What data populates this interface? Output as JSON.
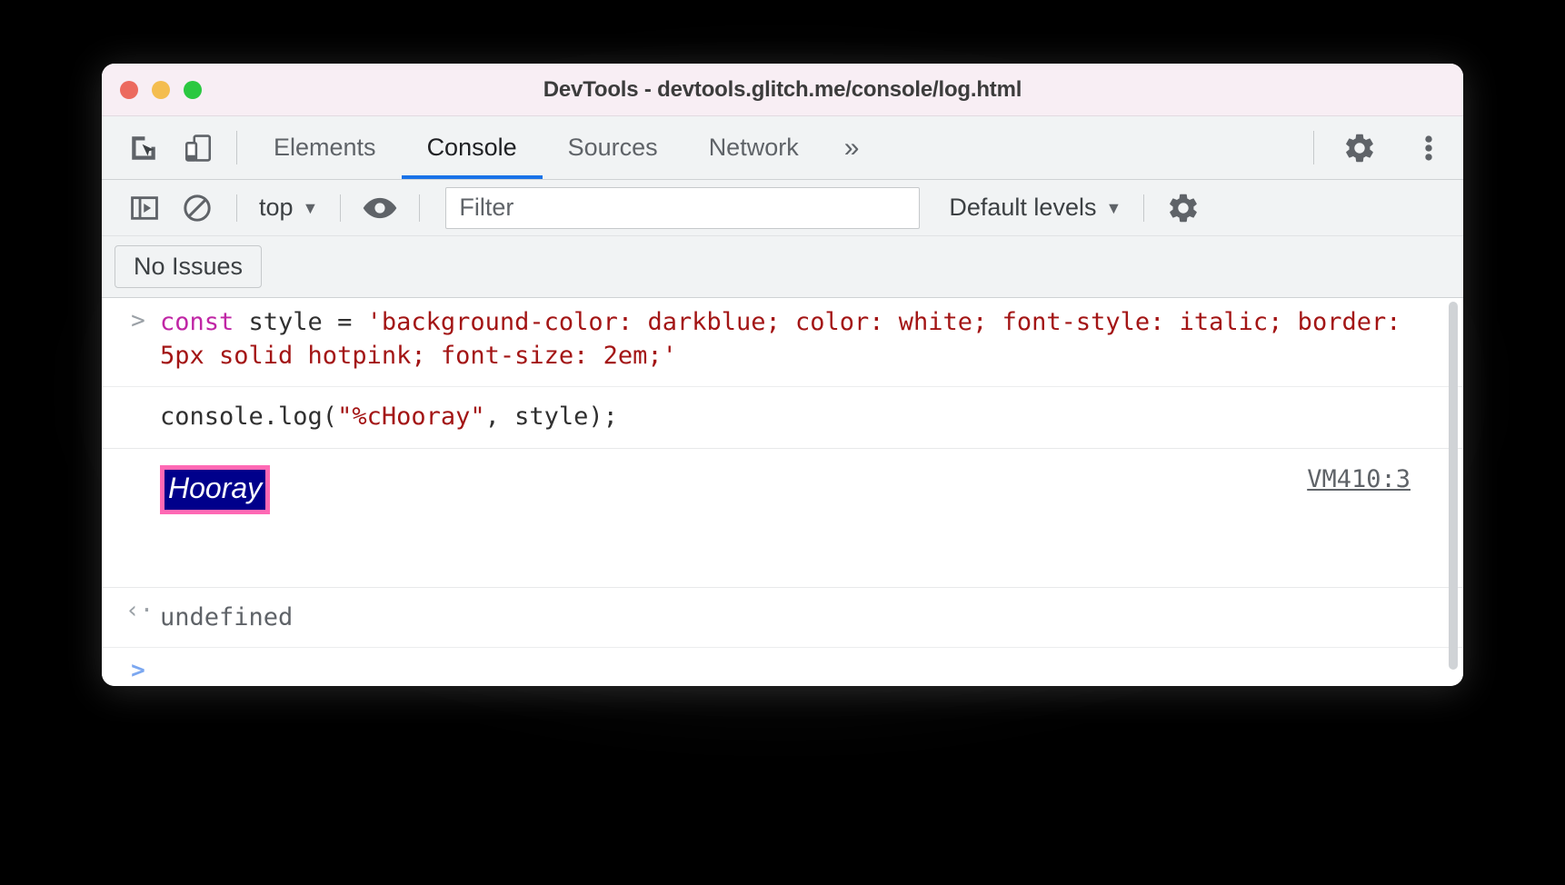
{
  "window": {
    "title": "DevTools - devtools.glitch.me/console/log.html",
    "traffic_lights": [
      "close",
      "minimize",
      "maximize"
    ],
    "colors": {
      "titlebar_bg": "#f8eef4",
      "toolbar_bg": "#f1f3f4",
      "accent": "#1a73e8",
      "close": "#ec6a5e",
      "minimize": "#f4bd4f",
      "maximize": "#2bc840"
    }
  },
  "tabbar": {
    "inspect_icon": "inspect-cursor-icon",
    "device_icon": "device-toolbar-icon",
    "tabs": [
      {
        "label": "Elements",
        "active": false
      },
      {
        "label": "Console",
        "active": true
      },
      {
        "label": "Sources",
        "active": false
      },
      {
        "label": "Network",
        "active": false
      }
    ],
    "more_label": "»",
    "settings_icon": "gear-icon",
    "menu_icon": "kebab-menu-icon"
  },
  "console_toolbar": {
    "sidebar_toggle_icon": "console-sidebar-icon",
    "clear_icon": "clear-console-icon",
    "context_label": "top",
    "context_caret": "▼",
    "eye_icon": "live-expression-eye-icon",
    "filter_placeholder": "Filter",
    "filter_value": "",
    "levels_label": "Default levels",
    "levels_caret": "▼",
    "settings_icon": "console-settings-gear-icon"
  },
  "issues": {
    "no_issues_label": "No Issues"
  },
  "console": {
    "input_prompt": ">",
    "input_code": {
      "kw": "const",
      "mid": " style = ",
      "str": "'background-color: darkblue; color: white; font-style: italic; border: 5px solid hotpink; font-size: 2em;'"
    },
    "log_call": {
      "before": "console.log(",
      "string_arg": "\"%cHooray\"",
      "after": ", style);"
    },
    "output": {
      "text": "Hooray",
      "background_color": "#00008b",
      "text_color": "#ffffff",
      "border": "5px solid hotpink",
      "border_color": "#ff69b4",
      "font_style": "italic",
      "font_size": "2em",
      "source_link": "VM410:3"
    },
    "result_prompt": "‹·",
    "result_value": "undefined",
    "new_prompt": ">"
  }
}
